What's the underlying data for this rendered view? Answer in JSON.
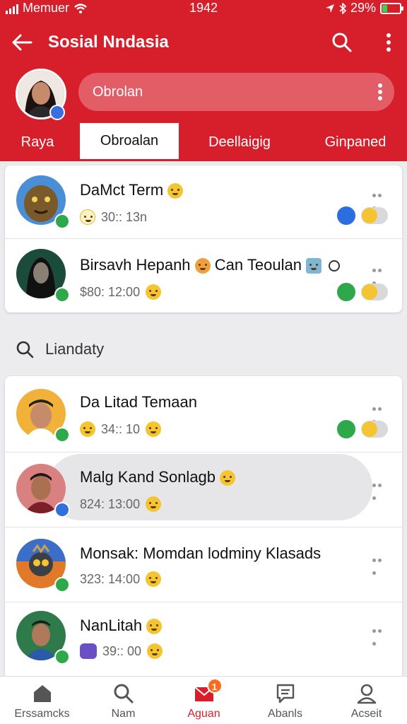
{
  "status": {
    "carrier": "Memuer",
    "time": "1942",
    "battery": "29%",
    "battery_level": 0.29
  },
  "header": {
    "title": "Sosial Nndasia",
    "chat_pill_label": "Obrolan"
  },
  "tabs": [
    {
      "label": "Raya",
      "active": false
    },
    {
      "label": "Obroalan",
      "active": true
    },
    {
      "label": "Deellaigig",
      "active": false
    },
    {
      "label": "Ginpaned",
      "active": false
    }
  ],
  "group1": [
    {
      "name": "DaMct Term",
      "time": "30:: 13n",
      "name_emoji": "surprised-emoji",
      "meta_emoji": "smile-emoji",
      "mini_avatar_color": "#2c6ee0"
    },
    {
      "name": "Birsavh Hepanh",
      "extra": "Can Teoulan",
      "time": "$80: 12:00",
      "meta_emoji": "grin-emoji",
      "mini_avatar_color": "#2ea84a"
    }
  ],
  "section_search": {
    "label": "Liandaty"
  },
  "group2": [
    {
      "name": "Da Litad Temaan",
      "time": "34:: 10",
      "meta_emoji": "grin-emoji",
      "meta_emoji_2": "surprised-emoji",
      "mini_avatar_color": "#2ea84a"
    },
    {
      "name": "Malg Kand Sonlagb",
      "time": "824: 13:00",
      "meta_emoji": "grin-emoji"
    },
    {
      "name": "Monsak: Momdan lodminy Klasads",
      "time": "323: 14:00",
      "meta_emoji": "grin-emoji"
    },
    {
      "name": "NanLitah",
      "time": "39:: 00",
      "meta_emoji": "grin-emoji"
    }
  ],
  "bottom_nav": [
    {
      "label": "Erssamcks",
      "icon": "home-icon"
    },
    {
      "label": "Nam",
      "icon": "search-icon"
    },
    {
      "label": "Aguan",
      "icon": "mail-icon",
      "badge": "1",
      "active": true
    },
    {
      "label": "Abanls",
      "icon": "message-icon"
    },
    {
      "label": "Acseit",
      "icon": "profile-icon"
    }
  ],
  "colors": {
    "brand": "#d71f2b",
    "verified": "#2ea84a",
    "badge": "#ff6a1f"
  }
}
